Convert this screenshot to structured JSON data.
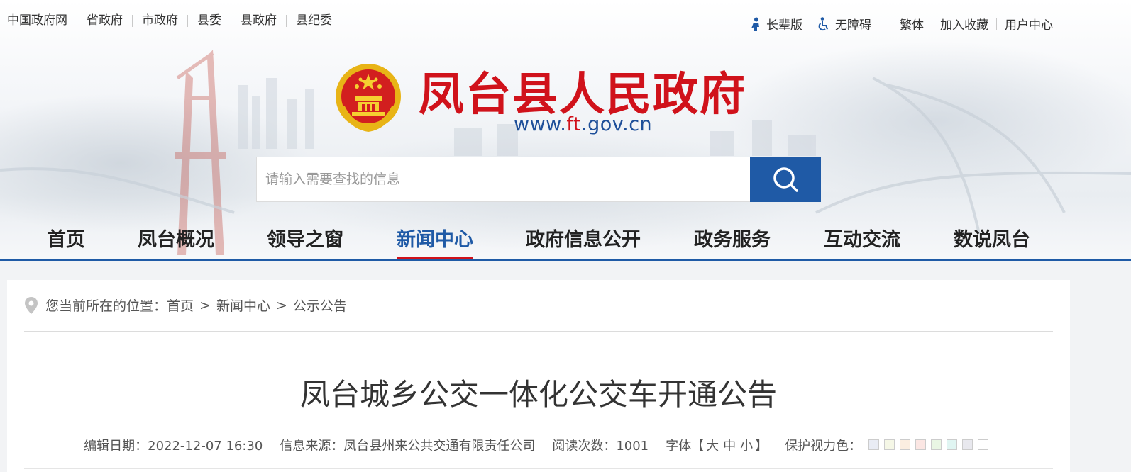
{
  "top_links": [
    "中国政府网",
    "省政府",
    "市政府",
    "县委",
    "县政府",
    "县纪委"
  ],
  "toolbar": {
    "elder_label": "长辈版",
    "accessibility_label": "无障碍",
    "traditional_label": "繁体",
    "bookmark_label": "加入收藏",
    "user_center_label": "用户中心"
  },
  "site": {
    "title": "凤台县人民政府",
    "url_prefix": "www.",
    "url_highlight": "ft",
    "url_suffix": ".gov.cn"
  },
  "search": {
    "placeholder": "请输入需要查找的信息",
    "button_icon": "search-icon"
  },
  "nav": {
    "items": [
      "首页",
      "凤台概况",
      "领导之窗",
      "新闻中心",
      "政府信息公开",
      "政务服务",
      "互动交流",
      "数说凤台"
    ],
    "active": "新闻中心"
  },
  "breadcrumb": {
    "prefix": "您当前所在的位置：",
    "items": [
      "首页",
      "新闻中心",
      "公示公告"
    ],
    "separator": ">"
  },
  "article": {
    "title": "凤台城乡公交一体化公交车开通公告",
    "edit_date_label": "编辑日期：2022-12-07 16:30",
    "source_label": "信息来源：凤台县州来公共交通有限责任公司",
    "views_label": "阅读次数：1001",
    "font_size_prefix": "字体【",
    "font_size_large": "大",
    "font_size_medium": "中",
    "font_size_small": "小",
    "font_size_suffix": "】",
    "eye_care_label": "保护视力色："
  },
  "eye_care_colors": [
    "#e9ecf4",
    "#f5f7e6",
    "#fbeee0",
    "#fbe6e3",
    "#e9f6e4",
    "#e0f5f2",
    "#e8e8ee",
    "#ffffff"
  ],
  "colors": {
    "accent_blue": "#1f5aa6",
    "title_red": "#d0121b"
  }
}
